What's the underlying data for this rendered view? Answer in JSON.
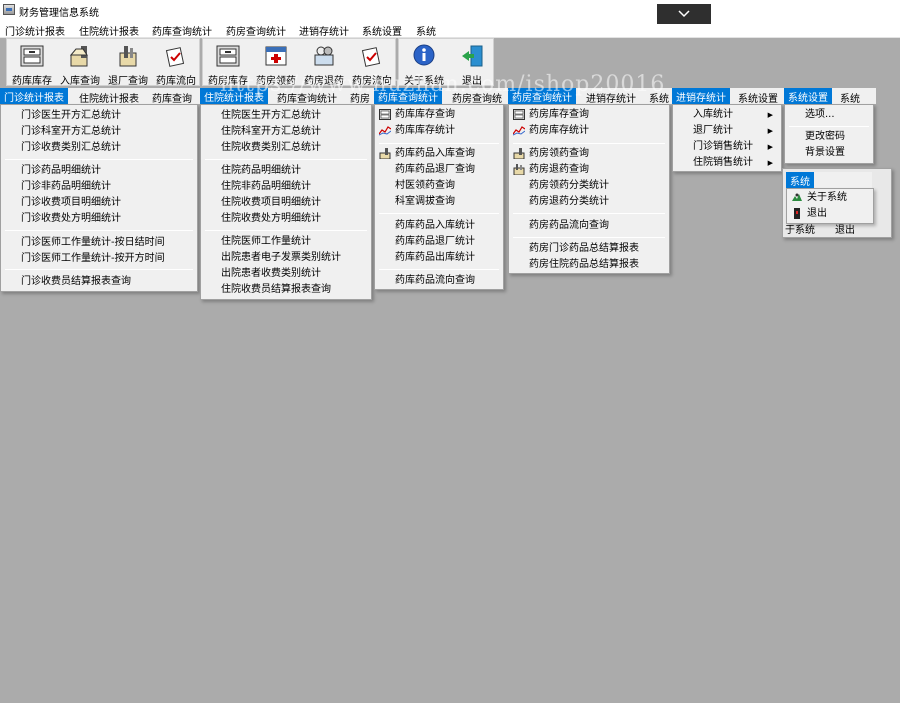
{
  "window": {
    "title": "财务管理信息系统",
    "dropdown_icon": "chevron-down-icon"
  },
  "menubar": [
    "门诊统计报表",
    "住院统计报表",
    "药库查询统计",
    "药房查询统计",
    "进销存统计",
    "系统设置",
    "系统"
  ],
  "toolbar": {
    "group1": [
      "药库库存",
      "入库查询",
      "退厂查询",
      "药库流向"
    ],
    "group2": [
      "药房库存",
      "药房领药",
      "药房退药",
      "药房流向"
    ],
    "group3": [
      "关于系统",
      "退出"
    ]
  },
  "menu_headers": {
    "a": [
      "门诊统计报表",
      "住院统计报表",
      "药库查询"
    ],
    "b": [
      "住院统计报表",
      "药库查询统计",
      "药房"
    ],
    "c": [
      "药库查询统计",
      "药房查询统"
    ],
    "d": [
      "药房查询统计",
      "进销存统计",
      "系统"
    ],
    "e": [
      "进销存统计",
      "系统设置"
    ],
    "f": [
      "系统设置",
      "系统"
    ]
  },
  "menu_outpatient": [
    "门诊医生开方汇总统计",
    "门诊科室开方汇总统计",
    "门诊收费类别汇总统计",
    "门诊药品明细统计",
    "门诊非药品明细统计",
    "门诊收费项目明细统计",
    "门诊收费处方明细统计",
    "门诊医师工作量统计-按日结时间",
    "门诊医师工作量统计-按开方时间",
    "门诊收费员结算报表查询"
  ],
  "menu_inpatient": [
    "住院医生开方汇总统计",
    "住院科室开方汇总统计",
    "住院收费类别汇总统计",
    "住院药品明细统计",
    "住院非药品明细统计",
    "住院收费项目明细统计",
    "住院收费处方明细统计",
    "住院医师工作量统计",
    "出院患者电子发票类别统计",
    "出院患者收费类别统计",
    "住院收费员结算报表查询"
  ],
  "menu_pharmacy_store": [
    "药库库存查询",
    "药库库存统计",
    "药库药品入库查询",
    "药库药品退厂查询",
    "村医领药查询",
    "科室调拔查询",
    "药库药品入库统计",
    "药库药品退厂统计",
    "药库药品出库统计",
    "药库药品流向查询"
  ],
  "menu_pharmacy_room": [
    "药房库存查询",
    "药房库存统计",
    "药房领药查询",
    "药房退药查询",
    "药房领药分类统计",
    "药房退药分类统计",
    "药房药品流向查询",
    "药房门诊药品总结算报表",
    "药房住院药品总结算报表"
  ],
  "menu_inventory": [
    "入库统计",
    "退厂统计",
    "门诊销售统计",
    "住院销售统计"
  ],
  "menu_settings": [
    "选项...",
    "更改密码",
    "背景设置"
  ],
  "system_panel": {
    "title": "系统",
    "items": [
      "关于系统",
      "退出"
    ],
    "behind": [
      "于系统",
      "退出"
    ]
  },
  "watermark": "https://www.huzhan.com/ishop20016",
  "colors": {
    "highlight": "#0078d7",
    "desktop": "#ababab",
    "menu_bg": "#f0f0f0"
  }
}
